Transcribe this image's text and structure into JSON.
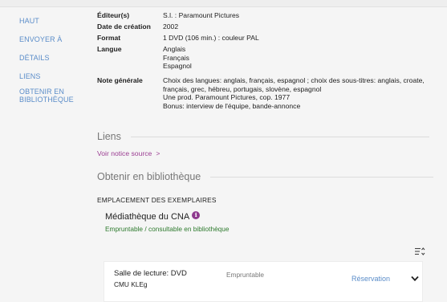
{
  "sidebar": {
    "items": [
      {
        "label": "Haut"
      },
      {
        "label": "Envoyer à"
      },
      {
        "label": "Détails"
      },
      {
        "label": "Liens"
      },
      {
        "label": "Obtenir en"
      },
      {
        "label": "bibliothèque"
      }
    ]
  },
  "details": {
    "editeur": {
      "label": "Éditeur(s)",
      "value": "S.l. : Paramount Pictures"
    },
    "date": {
      "label": "Date de création",
      "value": "2002"
    },
    "format": {
      "label": "Format",
      "value": "1 DVD (106 min.) : couleur PAL"
    },
    "langue": {
      "label": "Langue",
      "values": [
        "Anglais",
        "Français",
        "Espagnol"
      ]
    },
    "note": {
      "label": "Note générale",
      "lines": [
        "Choix des langues: anglais, français, espagnol ; choix des sous-titres: anglais, croate,",
        "français, grec, hébreu, portugais, slovène, espagnol",
        "Une prod. Paramount Pictures, cop. 1977",
        "Bonus: interview de l'équipe, bande-annonce"
      ]
    }
  },
  "liens": {
    "title": "Liens",
    "source_link": "Voir notice source",
    "chevron": ">"
  },
  "obtenir": {
    "title": "Obtenir en bibliothèque",
    "location_header": "Emplacement des exemplaires",
    "library": "Médiathèque du CNA",
    "info_glyph": "i",
    "availability": "Empruntable / consultable en bibliothèque",
    "item": {
      "location": "Salle de lecture: DVD",
      "call_number": "CMU KLEg",
      "status": "Empruntable",
      "action": "Réservation"
    }
  },
  "colors": {
    "link_blue": "#5b8dc9",
    "link_purple": "#9b3d92",
    "available_green": "#2d7a2d",
    "info_icon": "#8e3a8e"
  },
  "icons": {
    "sort": "sort-icon",
    "expand": "chevron-down-icon",
    "info": "info-icon"
  }
}
